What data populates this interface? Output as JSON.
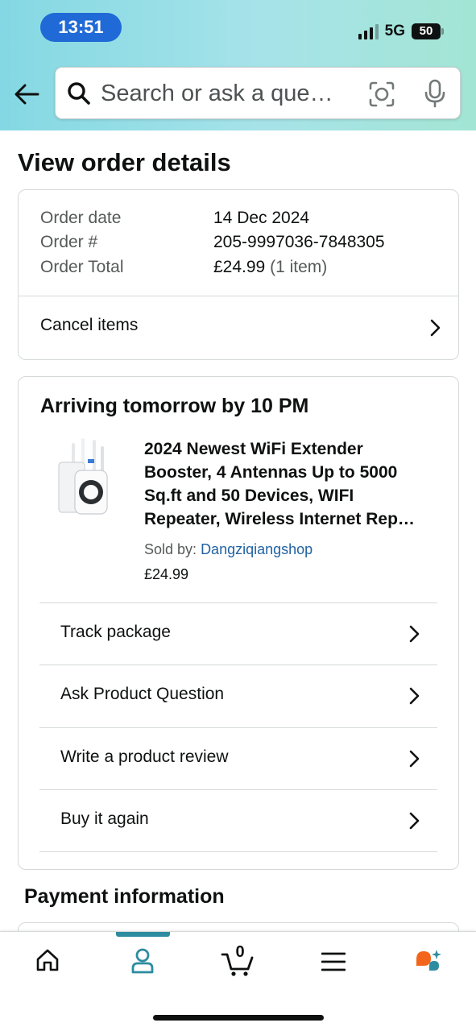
{
  "status_bar": {
    "time": "13:51",
    "network": "5G",
    "battery": "50",
    "battery_level": 0.5
  },
  "header": {
    "back_icon": "arrow-left-icon",
    "search_placeholder": "Search or ask a que…",
    "icons": [
      "search-icon",
      "camera-lens-icon",
      "microphone-icon"
    ]
  },
  "page": {
    "title": "View order details"
  },
  "order_summary": {
    "date_label": "Order date",
    "date_value": "14 Dec 2024",
    "number_label": "Order #",
    "number_value": "205-9997036-7848305",
    "total_label": "Order Total",
    "total_value": "£24.99",
    "total_items": "(1 item)",
    "cancel_label": "Cancel items"
  },
  "shipment": {
    "arriving": "Arriving tomorrow by 10 PM",
    "product": {
      "title_lines": [
        "2024 Newest WiFi Extender",
        "Booster, 4 Antennas Up to 5000",
        "Sq.ft and 50 Devices, WIFI",
        "Repeater, Wireless Internet Rep…"
      ],
      "sold_by_label": "Sold by:",
      "seller": "Dangziqiangshop",
      "price": "£24.99"
    },
    "actions": [
      {
        "label": "Track package"
      },
      {
        "label": "Ask Product Question"
      },
      {
        "label": "Write a product review"
      },
      {
        "label": "Buy it again"
      }
    ]
  },
  "payment": {
    "title": "Payment information"
  },
  "bottom_nav": {
    "items": [
      "home-icon",
      "account-icon",
      "cart-icon",
      "menu-icon",
      "rufus-icon"
    ],
    "active": "account-icon",
    "cart_count": "0",
    "accent_color": "#2d8ca0"
  }
}
